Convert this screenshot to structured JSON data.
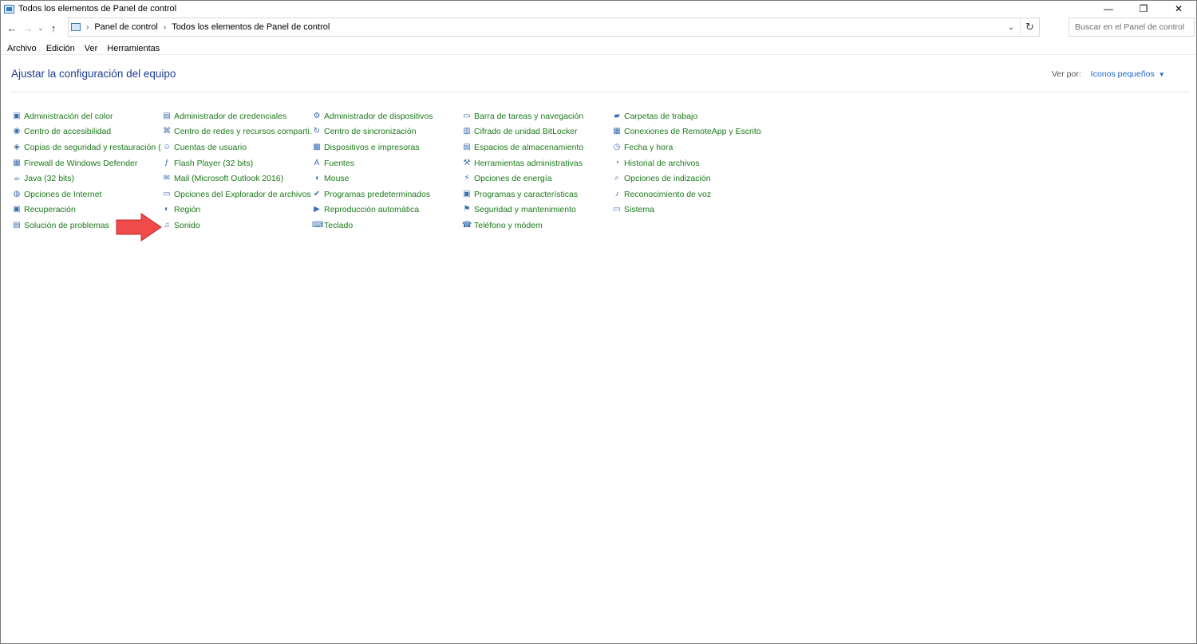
{
  "window": {
    "title": "Todos los elementos de Panel de control",
    "controls": {
      "minimize": "—",
      "restore": "❐",
      "close": "✕"
    }
  },
  "address": {
    "crumbs": [
      "Panel de control",
      "Todos los elementos de Panel de control"
    ],
    "search_placeholder": "Buscar en el Panel de control"
  },
  "menu": [
    "Archivo",
    "Edición",
    "Ver",
    "Herramientas"
  ],
  "header": {
    "title": "Ajustar la configuración del equipo",
    "view_by_label": "Ver por:",
    "view_by_value": "Iconos pequeños"
  },
  "items": [
    {
      "label": "Administración del color",
      "icon": "color-management-icon"
    },
    {
      "label": "Administrador de credenciales",
      "icon": "credential-manager-icon"
    },
    {
      "label": "Administrador de dispositivos",
      "icon": "device-manager-icon"
    },
    {
      "label": "Barra de tareas y navegación",
      "icon": "taskbar-icon"
    },
    {
      "label": "Carpetas de trabajo",
      "icon": "work-folders-icon"
    },
    {
      "label": "Centro de accesibilidad",
      "icon": "accessibility-icon"
    },
    {
      "label": "Centro de redes y recursos comparti...",
      "icon": "network-center-icon"
    },
    {
      "label": "Centro de sincronización",
      "icon": "sync-center-icon"
    },
    {
      "label": "Cifrado de unidad BitLocker",
      "icon": "bitlocker-icon"
    },
    {
      "label": "Conexiones de RemoteApp y Escrito...",
      "icon": "remoteapp-icon"
    },
    {
      "label": "Copias de seguridad y restauración (...",
      "icon": "backup-icon"
    },
    {
      "label": "Cuentas de usuario",
      "icon": "user-accounts-icon"
    },
    {
      "label": "Dispositivos e impresoras",
      "icon": "devices-printers-icon"
    },
    {
      "label": "Espacios de almacenamiento",
      "icon": "storage-spaces-icon"
    },
    {
      "label": "Fecha y hora",
      "icon": "date-time-icon"
    },
    {
      "label": "Firewall de Windows Defender",
      "icon": "firewall-icon"
    },
    {
      "label": "Flash Player (32 bits)",
      "icon": "flash-player-icon"
    },
    {
      "label": "Fuentes",
      "icon": "fonts-icon"
    },
    {
      "label": "Herramientas administrativas",
      "icon": "admin-tools-icon"
    },
    {
      "label": "Historial de archivos",
      "icon": "file-history-icon"
    },
    {
      "label": "Java (32 bits)",
      "icon": "java-icon"
    },
    {
      "label": "Mail (Microsoft Outlook 2016)",
      "icon": "mail-icon"
    },
    {
      "label": "Mouse",
      "icon": "mouse-icon"
    },
    {
      "label": "Opciones de energía",
      "icon": "power-options-icon"
    },
    {
      "label": "Opciones de indización",
      "icon": "indexing-options-icon"
    },
    {
      "label": "Opciones de Internet",
      "icon": "internet-options-icon"
    },
    {
      "label": "Opciones del Explorador de archivos",
      "icon": "explorer-options-icon"
    },
    {
      "label": "Programas predeterminados",
      "icon": "default-programs-icon"
    },
    {
      "label": "Programas y características",
      "icon": "programs-features-icon"
    },
    {
      "label": "Reconocimiento de voz",
      "icon": "speech-recognition-icon"
    },
    {
      "label": "Recuperación",
      "icon": "recovery-icon"
    },
    {
      "label": "Región",
      "icon": "region-icon"
    },
    {
      "label": "Reproducción automática",
      "icon": "autoplay-icon"
    },
    {
      "label": "Seguridad y mantenimiento",
      "icon": "security-maintenance-icon"
    },
    {
      "label": "Sistema",
      "icon": "system-icon"
    },
    {
      "label": "Solución de problemas",
      "icon": "troubleshooting-icon"
    },
    {
      "label": "Sonido",
      "icon": "sound-icon"
    },
    {
      "label": "Teclado",
      "icon": "keyboard-icon"
    },
    {
      "label": "Teléfono y módem",
      "icon": "phone-modem-icon"
    }
  ],
  "colors": {
    "link_green": "#1b7a1b",
    "title_blue": "#1e3d8f",
    "accent_blue": "#1e64c8",
    "annotation_red": "#f04a4a"
  }
}
